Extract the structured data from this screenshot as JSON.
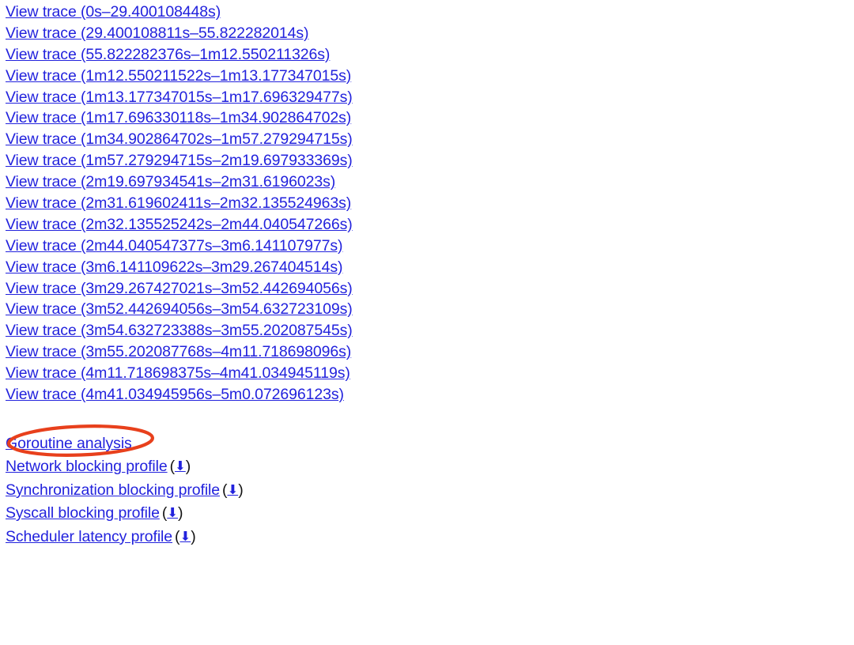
{
  "page": {
    "background_color": "#ffffff",
    "link_color": "#2222dd",
    "annotation_color": "#e8401c"
  },
  "trace_links": [
    {
      "label": "View trace (0s–29.400108448s)"
    },
    {
      "label": "View trace (29.400108811s–55.822282014s)"
    },
    {
      "label": "View trace (55.822282376s–1m12.550211326s)"
    },
    {
      "label": "View trace (1m12.550211522s–1m13.177347015s)"
    },
    {
      "label": "View trace (1m13.177347015s–1m17.696329477s)"
    },
    {
      "label": "View trace (1m17.696330118s–1m34.902864702s)"
    },
    {
      "label": "View trace (1m34.902864702s–1m57.279294715s)"
    },
    {
      "label": "View trace (1m57.279294715s–2m19.697933369s)"
    },
    {
      "label": "View trace (2m19.697934541s–2m31.6196023s)"
    },
    {
      "label": "View trace (2m31.619602411s–2m32.135524963s)"
    },
    {
      "label": "View trace (2m32.135525242s–2m44.040547266s)"
    },
    {
      "label": "View trace (2m44.040547377s–3m6.141107977s)"
    },
    {
      "label": "View trace (3m6.141109622s–3m29.267404514s)"
    },
    {
      "label": "View trace (3m29.267427021s–3m52.442694056s)"
    },
    {
      "label": "View trace (3m52.442694056s–3m54.632723109s)"
    },
    {
      "label": "View trace (3m54.632723388s–3m55.202087545s)"
    },
    {
      "label": "View trace (3m55.202087768s–4m11.718698096s)"
    },
    {
      "label": "View trace (4m11.718698375s–4m41.034945119s)"
    },
    {
      "label": "View trace (4m41.034945956s–5m0.072696123s)"
    }
  ],
  "profile_links": [
    {
      "label": "Goroutine analysis",
      "has_download": false,
      "highlighted": true
    },
    {
      "label": "Network blocking profile",
      "has_download": true,
      "highlighted": false
    },
    {
      "label": "Synchronization blocking profile",
      "has_download": true,
      "highlighted": false
    },
    {
      "label": "Syscall blocking profile",
      "has_download": true,
      "highlighted": false
    },
    {
      "label": "Scheduler latency profile",
      "has_download": true,
      "highlighted": false
    }
  ],
  "icons": {
    "download": "⬇",
    "download_name": "download-icon",
    "paren_open": "(",
    "paren_close": ")"
  },
  "annotation": {
    "name": "highlight-ellipse",
    "target": "Goroutine analysis",
    "shape": "ellipse",
    "color": "#e8401c"
  }
}
